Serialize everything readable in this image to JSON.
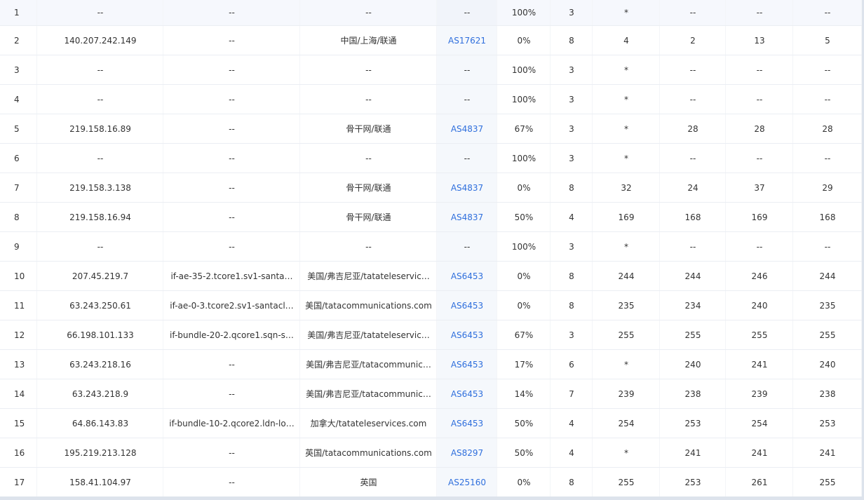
{
  "colors": {
    "link": "#2f6fdd",
    "text": "#333333",
    "row_border": "#ebeef3",
    "highlight_row": "#f6f8fd"
  },
  "rows": [
    {
      "hop": "1",
      "ip": "--",
      "host": "--",
      "geo": "--",
      "as": "--",
      "loss": "100%",
      "sent": "3",
      "last": "*",
      "best": "--",
      "worst": "--",
      "avg": "--"
    },
    {
      "hop": "2",
      "ip": "140.207.242.149",
      "host": "--",
      "geo": "中国/上海/联通",
      "as": "AS17621",
      "loss": "0%",
      "sent": "8",
      "last": "4",
      "best": "2",
      "worst": "13",
      "avg": "5"
    },
    {
      "hop": "3",
      "ip": "--",
      "host": "--",
      "geo": "--",
      "as": "--",
      "loss": "100%",
      "sent": "3",
      "last": "*",
      "best": "--",
      "worst": "--",
      "avg": "--"
    },
    {
      "hop": "4",
      "ip": "--",
      "host": "--",
      "geo": "--",
      "as": "--",
      "loss": "100%",
      "sent": "3",
      "last": "*",
      "best": "--",
      "worst": "--",
      "avg": "--"
    },
    {
      "hop": "5",
      "ip": "219.158.16.89",
      "host": "--",
      "geo": "骨干网/联通",
      "as": "AS4837",
      "loss": "67%",
      "sent": "3",
      "last": "*",
      "best": "28",
      "worst": "28",
      "avg": "28"
    },
    {
      "hop": "6",
      "ip": "--",
      "host": "--",
      "geo": "--",
      "as": "--",
      "loss": "100%",
      "sent": "3",
      "last": "*",
      "best": "--",
      "worst": "--",
      "avg": "--"
    },
    {
      "hop": "7",
      "ip": "219.158.3.138",
      "host": "--",
      "geo": "骨干网/联通",
      "as": "AS4837",
      "loss": "0%",
      "sent": "8",
      "last": "32",
      "best": "24",
      "worst": "37",
      "avg": "29"
    },
    {
      "hop": "8",
      "ip": "219.158.16.94",
      "host": "--",
      "geo": "骨干网/联通",
      "as": "AS4837",
      "loss": "50%",
      "sent": "4",
      "last": "169",
      "best": "168",
      "worst": "169",
      "avg": "168"
    },
    {
      "hop": "9",
      "ip": "--",
      "host": "--",
      "geo": "--",
      "as": "--",
      "loss": "100%",
      "sent": "3",
      "last": "*",
      "best": "--",
      "worst": "--",
      "avg": "--"
    },
    {
      "hop": "10",
      "ip": "207.45.219.7",
      "host": "if-ae-35-2.tcore1.sv1-santa…",
      "geo": "美国/弗吉尼亚/tatateleservic…",
      "as": "AS6453",
      "loss": "0%",
      "sent": "8",
      "last": "244",
      "best": "244",
      "worst": "246",
      "avg": "244"
    },
    {
      "hop": "11",
      "ip": "63.243.250.61",
      "host": "if-ae-0-3.tcore2.sv1-santacl…",
      "geo": "美国/tatacommunications.com",
      "as": "AS6453",
      "loss": "0%",
      "sent": "8",
      "last": "235",
      "best": "234",
      "worst": "240",
      "avg": "235"
    },
    {
      "hop": "12",
      "ip": "66.198.101.133",
      "host": "if-bundle-20-2.qcore1.sqn-s…",
      "geo": "美国/弗吉尼亚/tatateleservic…",
      "as": "AS6453",
      "loss": "67%",
      "sent": "3",
      "last": "255",
      "best": "255",
      "worst": "255",
      "avg": "255"
    },
    {
      "hop": "13",
      "ip": "63.243.218.16",
      "host": "--",
      "geo": "美国/弗吉尼亚/tatacommunic…",
      "as": "AS6453",
      "loss": "17%",
      "sent": "6",
      "last": "*",
      "best": "240",
      "worst": "241",
      "avg": "240"
    },
    {
      "hop": "14",
      "ip": "63.243.218.9",
      "host": "--",
      "geo": "美国/弗吉尼亚/tatacommunic…",
      "as": "AS6453",
      "loss": "14%",
      "sent": "7",
      "last": "239",
      "best": "238",
      "worst": "239",
      "avg": "238"
    },
    {
      "hop": "15",
      "ip": "64.86.143.83",
      "host": "if-bundle-10-2.qcore2.ldn-lo…",
      "geo": "加拿大/tatateleservices.com",
      "as": "AS6453",
      "loss": "50%",
      "sent": "4",
      "last": "254",
      "best": "253",
      "worst": "254",
      "avg": "253"
    },
    {
      "hop": "16",
      "ip": "195.219.213.128",
      "host": "--",
      "geo": "英国/tatacommunications.com",
      "as": "AS8297",
      "loss": "50%",
      "sent": "4",
      "last": "*",
      "best": "241",
      "worst": "241",
      "avg": "241"
    },
    {
      "hop": "17",
      "ip": "158.41.104.97",
      "host": "--",
      "geo": "英国",
      "as": "AS25160",
      "loss": "0%",
      "sent": "8",
      "last": "255",
      "best": "253",
      "worst": "261",
      "avg": "255"
    }
  ]
}
